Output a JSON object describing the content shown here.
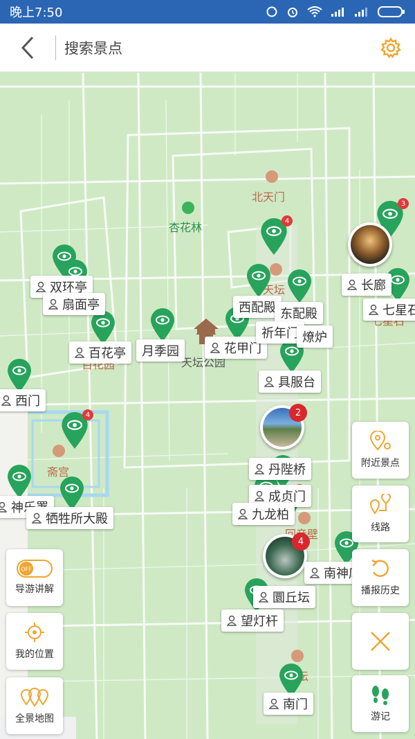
{
  "status": {
    "time": "晚上7:50"
  },
  "header": {
    "search_placeholder": "搜索景点"
  },
  "poi": {
    "north_gate": "北天门",
    "apricot": "杏花林",
    "park": "天坛公园",
    "fasting_palace": "斋宫",
    "hundred_flowers": "百花园",
    "qixing": "七星石",
    "tianji": "天坛",
    "circular_wall": "回音壁",
    "altar": "坛"
  },
  "tags": {
    "shuanghuan": "双环亭",
    "shanmian": "扇面亭",
    "baihua": "百花亭",
    "yueji": "月季园",
    "huajia": "花甲门",
    "xipei": "西配殿",
    "dongpei": "东配殿",
    "qinian": "祈年门",
    "burner": "燎炉",
    "jufu": "具服台",
    "changlang": "长廊",
    "qixingshi": "七星石",
    "ximen": "西门",
    "danbi": "丹陛桥",
    "shenyue": "神乐署",
    "xisheng": "牺牲所大殿",
    "nanmen_inner": "成贞门",
    "jiulong": "九龙柏",
    "nanshen": "南神库",
    "yuanqiu": "圜丘坛",
    "wangdeng": "望灯杆",
    "nanmen": "南门"
  },
  "badges": {
    "b1": "3",
    "b2": "4",
    "b3": "4",
    "b4": "3",
    "p1": "2",
    "p2": "4"
  },
  "controls": {
    "guide": "导游讲解",
    "guide_toggle": "OFF",
    "location": "我的位置",
    "fullmap": "全景地图",
    "nearby": "附近景点",
    "route": "线路",
    "history": "播报历史",
    "journal": "游记"
  },
  "colors": {
    "accent": "#f0a530",
    "pin": "#27a35c",
    "status_bar": "#2b66b5"
  }
}
